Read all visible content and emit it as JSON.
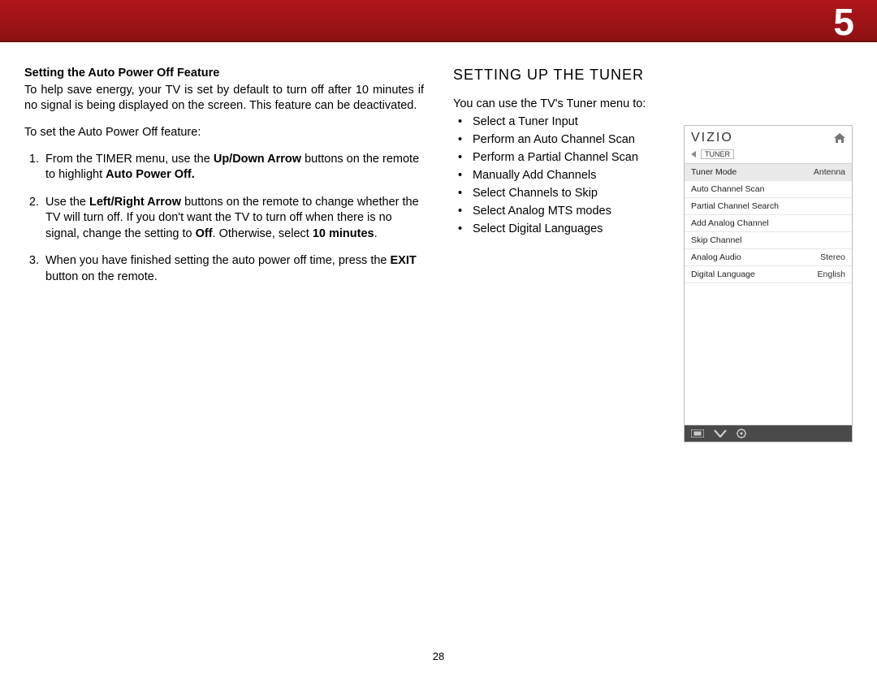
{
  "chapter_number": "5",
  "page_number": "28",
  "left": {
    "heading": "Setting the Auto Power Off Feature",
    "intro": "To help save energy, your TV is set by default to turn off after 10 minutes if no signal is being displayed on the screen. This feature can be deactivated.",
    "lead": "To set the Auto Power Off feature:",
    "steps": {
      "s1a": "From the TIMER menu, use the ",
      "s1b": "Up/Down Arrow",
      "s1c": " buttons on the remote to highlight ",
      "s1d": "Auto Power Off.",
      "s2a": "Use the ",
      "s2b": "Left/Right Arrow",
      "s2c": " buttons on the remote to change whether the TV will turn off. If you don't want the TV to turn off when there is no signal, change the setting to ",
      "s2d": "Off",
      "s2e": ". Otherwise, select ",
      "s2f": "10 minutes",
      "s2g": ".",
      "s3a": "When you have finished setting the auto power off time, press the ",
      "s3b": "EXIT",
      "s3c": " button on the remote."
    }
  },
  "right": {
    "heading": "SETTING UP THE TUNER",
    "intro": "You can use the TV's Tuner menu to:",
    "bullets": [
      "Select a Tuner Input",
      "Perform an Auto Channel Scan",
      "Perform a Partial Channel Scan",
      "Manually Add Channels",
      "Select Channels to Skip",
      "Select Analog MTS modes",
      "Select Digital Languages"
    ]
  },
  "osd": {
    "brand": "VIZIO",
    "breadcrumb": "TUNER",
    "items": [
      {
        "label": "Tuner Mode",
        "value": "Antenna",
        "sel": true
      },
      {
        "label": "Auto Channel Scan",
        "value": "",
        "sel": false
      },
      {
        "label": "Partial Channel Search",
        "value": "",
        "sel": false
      },
      {
        "label": "Add Analog Channel",
        "value": "",
        "sel": false
      },
      {
        "label": "Skip Channel",
        "value": "",
        "sel": false
      },
      {
        "label": "Analog Audio",
        "value": "Stereo",
        "sel": false
      },
      {
        "label": "Digital Language",
        "value": "English",
        "sel": false
      }
    ]
  }
}
